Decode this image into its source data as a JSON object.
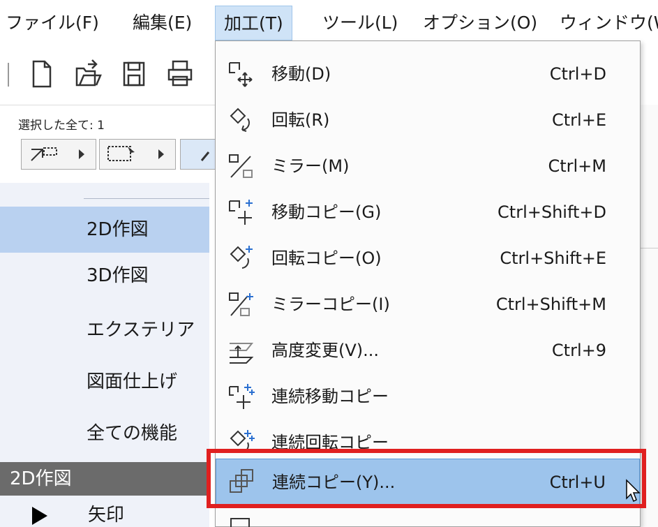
{
  "menubar": {
    "items": [
      "ファイル(F)",
      "編集(E)",
      "加工(T)",
      "ツール(L)",
      "オプション(O)",
      "ウィンドウ(W"
    ]
  },
  "selection": {
    "label": "選択した全て: 1"
  },
  "nav": {
    "items": [
      "2D作図",
      "3D作図",
      "エクステリア",
      "図面仕上げ",
      "全ての機能"
    ],
    "section_header": "2D作図",
    "bottom_label": "矢印"
  },
  "dropdown": {
    "items": [
      {
        "label": "移動(D)",
        "shortcut": "Ctrl+D",
        "icon": "move-icon"
      },
      {
        "label": "回転(R)",
        "shortcut": "Ctrl+E",
        "icon": "rotate-icon"
      },
      {
        "label": "ミラー(M)",
        "shortcut": "Ctrl+M",
        "icon": "mirror-icon"
      },
      {
        "label": "移動コピー(G)",
        "shortcut": "Ctrl+Shift+D",
        "icon": "move-copy-icon"
      },
      {
        "label": "回転コピー(O)",
        "shortcut": "Ctrl+Shift+E",
        "icon": "rotate-copy-icon"
      },
      {
        "label": "ミラーコピー(I)",
        "shortcut": "Ctrl+Shift+M",
        "icon": "mirror-copy-icon"
      },
      {
        "label": "高度変更(V)...",
        "shortcut": "Ctrl+9",
        "icon": "elevation-icon"
      },
      {
        "label": "連続移動コピー",
        "shortcut": "",
        "icon": "multi-move-copy-icon"
      },
      {
        "label": "連続回転コピー",
        "shortcut": "",
        "icon": "multi-rotate-copy-icon"
      },
      {
        "label": "連続コピー(Y)...",
        "shortcut": "Ctrl+U",
        "icon": "multiply-copy-icon"
      }
    ]
  },
  "colors": {
    "highlight": "#9dc4ec",
    "nav_active": "#b9d1f0",
    "red_box": "#e02020",
    "section_header": "#6b6b6b"
  }
}
